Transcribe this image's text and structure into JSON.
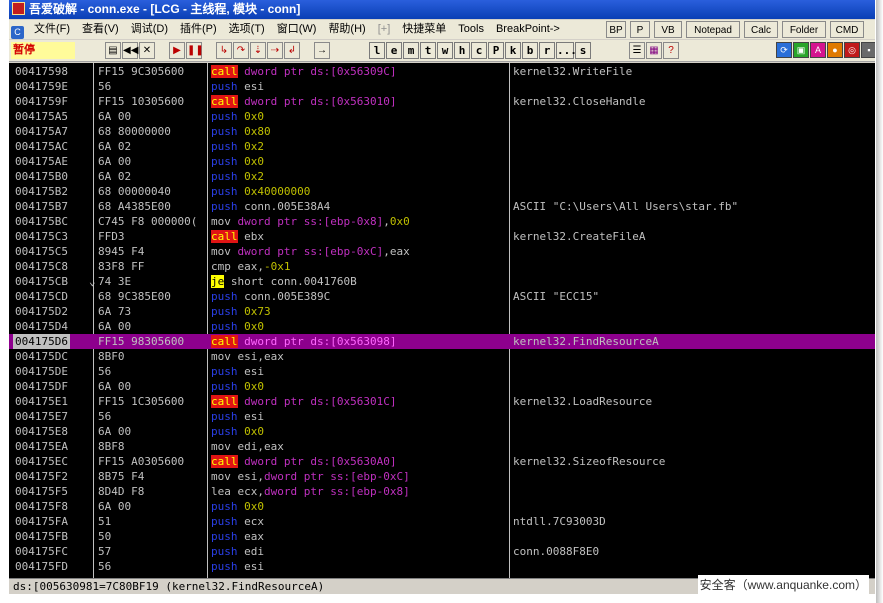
{
  "window": {
    "title": "吾爱破解 - conn.exe - [LCG -  主线程, 模块 - conn]"
  },
  "menu": {
    "items": [
      "文件(F)",
      "查看(V)",
      "调试(D)",
      "插件(P)",
      "选项(T)",
      "窗口(W)",
      "帮助(H)",
      "[+]",
      "快捷菜单",
      "Tools",
      "BreakPoint->"
    ],
    "right_buttons": [
      "BP",
      "P",
      "VB",
      "Notepad",
      "Calc",
      "Folder",
      "CMD"
    ]
  },
  "toolbar": {
    "status": "暂停",
    "letters": [
      "l",
      "e",
      "m",
      "t",
      "w",
      "h",
      "c",
      "P",
      "k",
      "b",
      "r",
      "...",
      "s"
    ]
  },
  "disasm": {
    "rows": [
      {
        "addr": "00417598",
        "hex": "FF15 9C305600",
        "mn": "call",
        "ops": [
          [
            "mem",
            "dword ptr ds:[0x56309C]"
          ]
        ],
        "comment": "kernel32.WriteFile"
      },
      {
        "addr": "0041759E",
        "hex": "56",
        "mn": "push",
        "ops": [
          [
            "reg",
            "esi"
          ]
        ],
        "comment": ""
      },
      {
        "addr": "0041759F",
        "hex": "FF15 10305600",
        "mn": "call",
        "ops": [
          [
            "mem",
            "dword ptr ds:[0x563010]"
          ]
        ],
        "comment": "kernel32.CloseHandle"
      },
      {
        "addr": "004175A5",
        "hex": "6A 00",
        "mn": "push",
        "ops": [
          [
            "imm",
            "0x0"
          ]
        ],
        "comment": ""
      },
      {
        "addr": "004175A7",
        "hex": "68 80000000",
        "mn": "push",
        "ops": [
          [
            "imm",
            "0x80"
          ]
        ],
        "comment": ""
      },
      {
        "addr": "004175AC",
        "hex": "6A 02",
        "mn": "push",
        "ops": [
          [
            "imm",
            "0x2"
          ]
        ],
        "comment": ""
      },
      {
        "addr": "004175AE",
        "hex": "6A 00",
        "mn": "push",
        "ops": [
          [
            "imm",
            "0x0"
          ]
        ],
        "comment": ""
      },
      {
        "addr": "004175B0",
        "hex": "6A 02",
        "mn": "push",
        "ops": [
          [
            "imm",
            "0x2"
          ]
        ],
        "comment": ""
      },
      {
        "addr": "004175B2",
        "hex": "68 00000040",
        "mn": "push",
        "ops": [
          [
            "imm",
            "0x40000000"
          ]
        ],
        "comment": ""
      },
      {
        "addr": "004175B7",
        "hex": "68 A4385E00",
        "mn": "push",
        "ops": [
          [
            "lbl",
            "conn.005E38A4"
          ]
        ],
        "comment": "ASCII \"C:\\Users\\All Users\\star.fb\""
      },
      {
        "addr": "004175BC",
        "hex": "C745 F8 000000(",
        "mn": "mov",
        "ops": [
          [
            "mem",
            "dword ptr ss:[ebp-0x8]"
          ],
          [
            "reg",
            ","
          ],
          [
            "imm",
            "0x0"
          ]
        ],
        "comment": ""
      },
      {
        "addr": "004175C3",
        "hex": "FFD3",
        "mn": "call",
        "ops": [
          [
            "reg",
            "ebx"
          ]
        ],
        "comment": "kernel32.CreateFileA"
      },
      {
        "addr": "004175C5",
        "hex": "8945 F4",
        "mn": "mov",
        "ops": [
          [
            "mem",
            "dword ptr ss:[ebp-0xC]"
          ],
          [
            "reg",
            ",eax"
          ]
        ],
        "comment": ""
      },
      {
        "addr": "004175C8",
        "hex": "83F8 FF",
        "mn": "cmp",
        "ops": [
          [
            "reg",
            "eax,"
          ],
          [
            "imm",
            "-0x1"
          ]
        ],
        "comment": ""
      },
      {
        "addr": "004175CB",
        "hex": "74 3E",
        "mn": "je",
        "ops": [
          [
            "lbl",
            "short conn.0041760B"
          ]
        ],
        "comment": "",
        "jmark": "⌄"
      },
      {
        "addr": "004175CD",
        "hex": "68 9C385E00",
        "mn": "push",
        "ops": [
          [
            "lbl",
            "conn.005E389C"
          ]
        ],
        "comment": "ASCII \"ECC15\""
      },
      {
        "addr": "004175D2",
        "hex": "6A 73",
        "mn": "push",
        "ops": [
          [
            "imm",
            "0x73"
          ]
        ],
        "comment": ""
      },
      {
        "addr": "004175D4",
        "hex": "6A 00",
        "mn": "push",
        "ops": [
          [
            "imm",
            "0x0"
          ]
        ],
        "comment": ""
      },
      {
        "addr": "004175D6",
        "hex": "FF15 98305600",
        "mn": "call",
        "ops": [
          [
            "mem",
            "dword ptr ds:[0x563098]"
          ]
        ],
        "comment": "kernel32.FindResourceA",
        "selected": true
      },
      {
        "addr": "004175DC",
        "hex": "8BF0",
        "mn": "mov",
        "ops": [
          [
            "reg",
            "esi,eax"
          ]
        ],
        "comment": ""
      },
      {
        "addr": "004175DE",
        "hex": "56",
        "mn": "push",
        "ops": [
          [
            "reg",
            "esi"
          ]
        ],
        "comment": ""
      },
      {
        "addr": "004175DF",
        "hex": "6A 00",
        "mn": "push",
        "ops": [
          [
            "imm",
            "0x0"
          ]
        ],
        "comment": ""
      },
      {
        "addr": "004175E1",
        "hex": "FF15 1C305600",
        "mn": "call",
        "ops": [
          [
            "mem",
            "dword ptr ds:[0x56301C]"
          ]
        ],
        "comment": "kernel32.LoadResource"
      },
      {
        "addr": "004175E7",
        "hex": "56",
        "mn": "push",
        "ops": [
          [
            "reg",
            "esi"
          ]
        ],
        "comment": ""
      },
      {
        "addr": "004175E8",
        "hex": "6A 00",
        "mn": "push",
        "ops": [
          [
            "imm",
            "0x0"
          ]
        ],
        "comment": ""
      },
      {
        "addr": "004175EA",
        "hex": "8BF8",
        "mn": "mov",
        "ops": [
          [
            "reg",
            "edi,eax"
          ]
        ],
        "comment": ""
      },
      {
        "addr": "004175EC",
        "hex": "FF15 A0305600",
        "mn": "call",
        "ops": [
          [
            "mem",
            "dword ptr ds:[0x5630A0]"
          ]
        ],
        "comment": "kernel32.SizeofResource"
      },
      {
        "addr": "004175F2",
        "hex": "8B75 F4",
        "mn": "mov",
        "ops": [
          [
            "reg",
            "esi,"
          ],
          [
            "mem",
            "dword ptr ss:[ebp-0xC]"
          ]
        ],
        "comment": ""
      },
      {
        "addr": "004175F5",
        "hex": "8D4D F8",
        "mn": "lea",
        "ops": [
          [
            "reg",
            "ecx,"
          ],
          [
            "mem",
            "dword ptr ss:[ebp-0x8]"
          ]
        ],
        "comment": ""
      },
      {
        "addr": "004175F8",
        "hex": "6A 00",
        "mn": "push",
        "ops": [
          [
            "imm",
            "0x0"
          ]
        ],
        "comment": ""
      },
      {
        "addr": "004175FA",
        "hex": "51",
        "mn": "push",
        "ops": [
          [
            "reg",
            "ecx"
          ]
        ],
        "comment": "ntdll.7C93003D"
      },
      {
        "addr": "004175FB",
        "hex": "50",
        "mn": "push",
        "ops": [
          [
            "reg",
            "eax"
          ]
        ],
        "comment": ""
      },
      {
        "addr": "004175FC",
        "hex": "57",
        "mn": "push",
        "ops": [
          [
            "reg",
            "edi"
          ]
        ],
        "comment": "conn.0088F8E0"
      },
      {
        "addr": "004175FD",
        "hex": "56",
        "mn": "push",
        "ops": [
          [
            "reg",
            "esi"
          ]
        ],
        "comment": ""
      }
    ]
  },
  "infobar": {
    "text": "ds:[005630981=7C80BF19 (kernel32.FindResourceA)"
  },
  "watermark": "安全客（www.anquanke.com）"
}
